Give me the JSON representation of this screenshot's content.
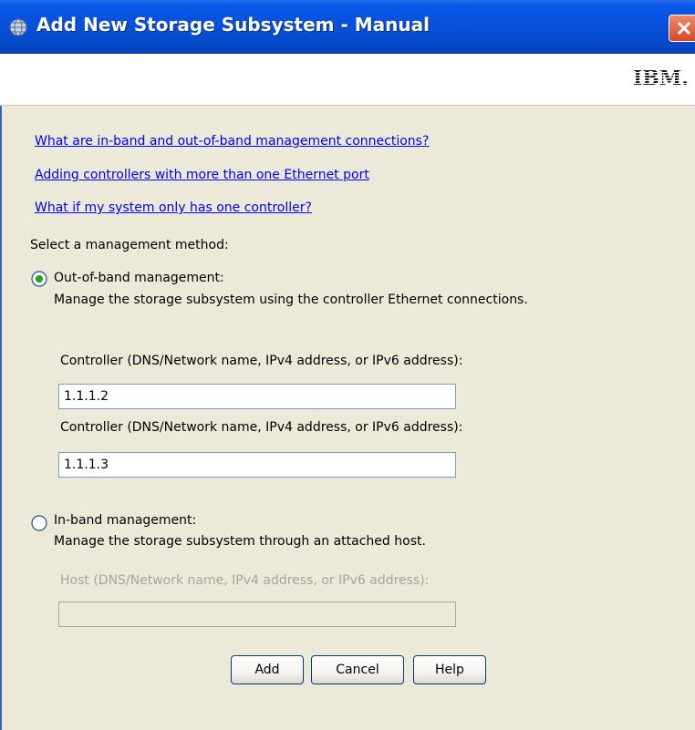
{
  "window": {
    "title": "Add New Storage Subsystem - Manual",
    "logo_text": "IBM."
  },
  "help_links": [
    {
      "label": "What are in-band and out-of-band management connections?"
    },
    {
      "label": "Adding controllers with more than one Ethernet port"
    },
    {
      "label": "What if my system only has one controller?"
    }
  ],
  "method_prompt": "Select a management method:",
  "out_of_band": {
    "selected": true,
    "label": "Out-of-band management:",
    "description": "Manage the storage subsystem using the controller Ethernet connections.",
    "controller1_label": "Controller (DNS/Network name, IPv4 address, or IPv6 address):",
    "controller1_value": "1.1.1.2",
    "controller2_label": "Controller (DNS/Network name, IPv4 address, or IPv6 address):",
    "controller2_value": "1.1.1.3"
  },
  "in_band": {
    "selected": false,
    "label": "In-band management:",
    "description": "Manage the storage subsystem through an attached host.",
    "host_label": "Host (DNS/Network name, IPv4 address, or IPv6 address):",
    "host_value": ""
  },
  "buttons": {
    "add": "Add",
    "cancel": "Cancel",
    "help": "Help"
  },
  "colors": {
    "titlebar": "#0750d8",
    "link": "#0000ee",
    "panel": "#ece9d8",
    "close": "#d8472a"
  }
}
